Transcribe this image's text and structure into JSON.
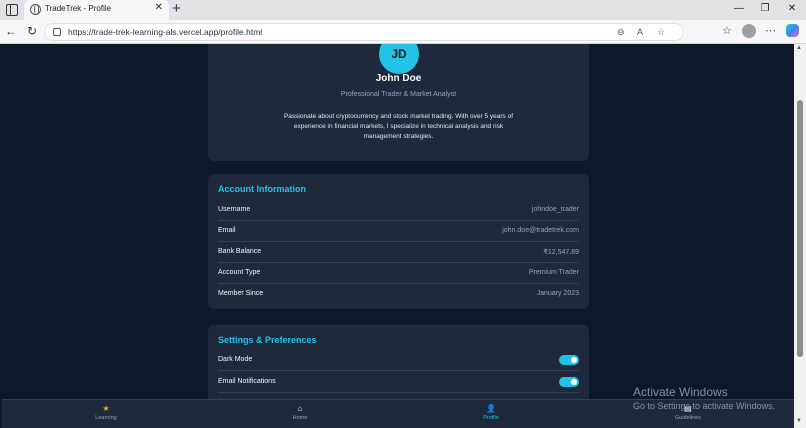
{
  "browser": {
    "tab_title": "TradeTrek - Profile",
    "url": "https://trade-trek-learning-als.vercel.app/profile.html"
  },
  "profile": {
    "initials": "JD",
    "name": "John Doe",
    "role": "Professional Trader & Market Analyst",
    "bio": "Passionate about cryptocurrency and stock market trading. With over 5 years of experience in financial markets, I specialize in technical analysis and risk management strategies."
  },
  "account": {
    "title": "Account Information",
    "rows": [
      {
        "label": "Username",
        "value": "johndoe_trader"
      },
      {
        "label": "Email",
        "value": "john.doe@tradetrek.com"
      },
      {
        "label": "Bank Balance",
        "value": "₹12,547.89"
      },
      {
        "label": "Account Type",
        "value": "Premium Trader"
      },
      {
        "label": "Member Since",
        "value": "January 2023"
      }
    ]
  },
  "preferences": {
    "title": "Settings & Preferences",
    "rows": [
      {
        "label": "Dark Mode",
        "enabled": true
      },
      {
        "label": "Email Notifications",
        "enabled": true
      }
    ]
  },
  "bottom_nav": {
    "items": [
      {
        "label": "Learning",
        "icon": "star-icon"
      },
      {
        "label": "Home",
        "icon": "home-icon"
      },
      {
        "label": "Profile",
        "icon": "user-icon",
        "active": true
      },
      {
        "label": "Guidelines",
        "icon": "document-icon"
      }
    ]
  },
  "watermark": {
    "title": "Activate Windows",
    "subtitle": "Go to Settings to activate Windows."
  },
  "colors": {
    "accent": "#22c3e6",
    "background": "#0f172a",
    "card": "#1e293b"
  }
}
